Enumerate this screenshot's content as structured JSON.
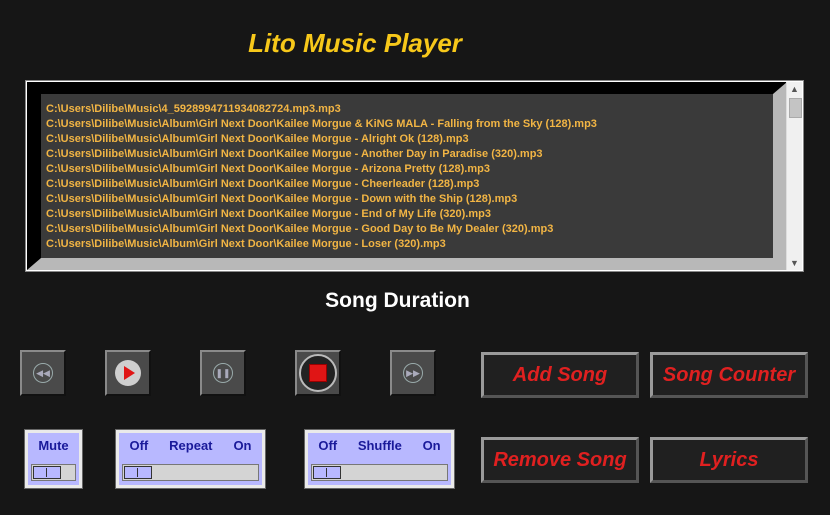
{
  "app": {
    "title": "Lito Music Player"
  },
  "playlist": {
    "items": [
      "C:\\Users\\Dilibe\\Music\\4_5928994711934082724.mp3.mp3",
      "C:\\Users\\Dilibe\\Music\\Album\\Girl Next Door\\Kailee Morgue & KiNG MALA - Falling from the Sky (128).mp3",
      "C:\\Users\\Dilibe\\Music\\Album\\Girl Next Door\\Kailee Morgue - Alright Ok (128).mp3",
      "C:\\Users\\Dilibe\\Music\\Album\\Girl Next Door\\Kailee Morgue - Another Day in Paradise (320).mp3",
      "C:\\Users\\Dilibe\\Music\\Album\\Girl Next Door\\Kailee Morgue - Arizona Pretty (128).mp3",
      "C:\\Users\\Dilibe\\Music\\Album\\Girl Next Door\\Kailee Morgue - Cheerleader (128).mp3",
      "C:\\Users\\Dilibe\\Music\\Album\\Girl Next Door\\Kailee Morgue - Down with the Ship (128).mp3",
      "C:\\Users\\Dilibe\\Music\\Album\\Girl Next Door\\Kailee Morgue - End of My Life (320).mp3",
      "C:\\Users\\Dilibe\\Music\\Album\\Girl Next Door\\Kailee Morgue - Good Day to Be My Dealer (320).mp3",
      "C:\\Users\\Dilibe\\Music\\Album\\Girl Next Door\\Kailee Morgue - Loser (320).mp3"
    ]
  },
  "status": {
    "duration_label": "Song Duration"
  },
  "transport": {
    "rewind_icon": "rewind-icon",
    "play_icon": "play-icon",
    "pause_icon": "pause-icon",
    "stop_icon": "stop-icon",
    "forward_icon": "fast-forward-icon"
  },
  "actions": {
    "add_song": "Add Song",
    "song_counter": "Song Counter",
    "remove_song": "Remove Song",
    "lyrics": "Lyrics"
  },
  "toggles": {
    "mute": {
      "label": "Mute"
    },
    "repeat": {
      "off": "Off",
      "label": "Repeat",
      "on": "On",
      "state": "off"
    },
    "shuffle": {
      "off": "Off",
      "label": "Shuffle",
      "on": "On",
      "state": "off"
    }
  },
  "colors": {
    "title": "#f7c81a",
    "song_text": "#f2b544",
    "action_text": "#e02020",
    "toggle_bg": "#b8b8ff",
    "toggle_text": "#1a1a9a"
  }
}
